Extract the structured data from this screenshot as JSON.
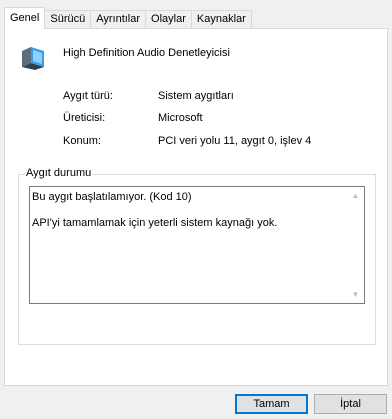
{
  "tabs": [
    {
      "label": "Genel"
    },
    {
      "label": "Sürücü"
    },
    {
      "label": "Ayrıntılar"
    },
    {
      "label": "Olaylar"
    },
    {
      "label": "Kaynaklar"
    }
  ],
  "device": {
    "icon": "audio-device-icon",
    "name": "High Definition Audio Denetleyicisi"
  },
  "properties": {
    "type_label": "Aygıt türü:",
    "type_value": "Sistem aygıtları",
    "manufacturer_label": "Üreticisi:",
    "manufacturer_value": "Microsoft",
    "location_label": "Konum:",
    "location_value": "PCI veri yolu 11, aygıt 0, işlev 4"
  },
  "status": {
    "group_title": "Aygıt durumu",
    "line1": "Bu aygıt başlatılamıyor. (Kod 10)",
    "line2": "API'yi tamamlamak için yeterli sistem kaynağı yok."
  },
  "buttons": {
    "ok": "Tamam",
    "cancel": "İptal"
  },
  "colors": {
    "focus": "#0078d7"
  }
}
